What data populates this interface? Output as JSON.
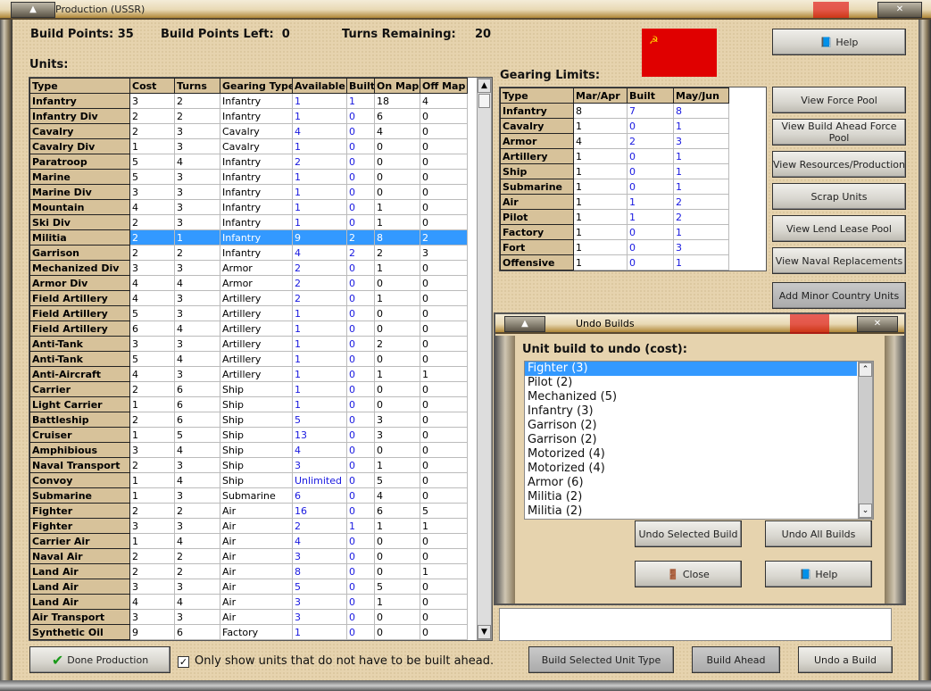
{
  "window": {
    "title": "Production (USSR)"
  },
  "stats": {
    "build_points": "Build Points: 35",
    "build_points_left": "Build Points Left:  0",
    "turns_remaining_label": "Turns Remaining:",
    "turns_remaining": "20"
  },
  "units": {
    "heading": "Units:",
    "columns": [
      "Type",
      "Cost",
      "Turns",
      "Gearing Type",
      "Available",
      "Built",
      "On Map",
      "Off Map"
    ],
    "selected_index": 9,
    "rows": [
      [
        "Infantry",
        "3",
        "2",
        "Infantry",
        "1",
        "1",
        "18",
        "4"
      ],
      [
        "Infantry Div",
        "2",
        "2",
        "Infantry",
        "1",
        "0",
        "6",
        "0"
      ],
      [
        "Cavalry",
        "2",
        "3",
        "Cavalry",
        "4",
        "0",
        "4",
        "0"
      ],
      [
        "Cavalry Div",
        "1",
        "3",
        "Cavalry",
        "1",
        "0",
        "0",
        "0"
      ],
      [
        "Paratroop",
        "5",
        "4",
        "Infantry",
        "2",
        "0",
        "0",
        "0"
      ],
      [
        "Marine",
        "5",
        "3",
        "Infantry",
        "1",
        "0",
        "0",
        "0"
      ],
      [
        "Marine Div",
        "3",
        "3",
        "Infantry",
        "1",
        "0",
        "0",
        "0"
      ],
      [
        "Mountain",
        "4",
        "3",
        "Infantry",
        "1",
        "0",
        "1",
        "0"
      ],
      [
        "Ski Div",
        "2",
        "3",
        "Infantry",
        "1",
        "0",
        "1",
        "0"
      ],
      [
        "Militia",
        "2",
        "1",
        "Infantry",
        "9",
        "2",
        "8",
        "2"
      ],
      [
        "Garrison",
        "2",
        "2",
        "Infantry",
        "4",
        "2",
        "2",
        "3"
      ],
      [
        "Mechanized Div",
        "3",
        "3",
        "Armor",
        "2",
        "0",
        "1",
        "0"
      ],
      [
        "Armor Div",
        "4",
        "4",
        "Armor",
        "2",
        "0",
        "0",
        "0"
      ],
      [
        "Field Artillery",
        "4",
        "3",
        "Artillery",
        "2",
        "0",
        "1",
        "0"
      ],
      [
        "Field Artillery",
        "5",
        "3",
        "Artillery",
        "1",
        "0",
        "0",
        "0"
      ],
      [
        "Field Artillery",
        "6",
        "4",
        "Artillery",
        "1",
        "0",
        "0",
        "0"
      ],
      [
        "Anti-Tank",
        "3",
        "3",
        "Artillery",
        "1",
        "0",
        "2",
        "0"
      ],
      [
        "Anti-Tank",
        "5",
        "4",
        "Artillery",
        "1",
        "0",
        "0",
        "0"
      ],
      [
        "Anti-Aircraft",
        "4",
        "3",
        "Artillery",
        "1",
        "0",
        "1",
        "1"
      ],
      [
        "Carrier",
        "2",
        "6",
        "Ship",
        "1",
        "0",
        "0",
        "0"
      ],
      [
        "Light Carrier",
        "1",
        "6",
        "Ship",
        "1",
        "0",
        "0",
        "0"
      ],
      [
        "Battleship",
        "2",
        "6",
        "Ship",
        "5",
        "0",
        "3",
        "0"
      ],
      [
        "Cruiser",
        "1",
        "5",
        "Ship",
        "13",
        "0",
        "3",
        "0"
      ],
      [
        "Amphibious",
        "3",
        "4",
        "Ship",
        "4",
        "0",
        "0",
        "0"
      ],
      [
        "Naval Transport",
        "2",
        "3",
        "Ship",
        "3",
        "0",
        "1",
        "0"
      ],
      [
        "Convoy",
        "1",
        "4",
        "Ship",
        "Unlimited",
        "0",
        "5",
        "0"
      ],
      [
        "Submarine",
        "1",
        "3",
        "Submarine",
        "6",
        "0",
        "4",
        "0"
      ],
      [
        "Fighter",
        "2",
        "2",
        "Air",
        "16",
        "0",
        "6",
        "5"
      ],
      [
        "Fighter",
        "3",
        "3",
        "Air",
        "2",
        "1",
        "1",
        "1"
      ],
      [
        "Carrier Air",
        "1",
        "4",
        "Air",
        "4",
        "0",
        "0",
        "0"
      ],
      [
        "Naval Air",
        "2",
        "2",
        "Air",
        "3",
        "0",
        "0",
        "0"
      ],
      [
        "Land Air",
        "2",
        "2",
        "Air",
        "8",
        "0",
        "0",
        "1"
      ],
      [
        "Land Air",
        "3",
        "3",
        "Air",
        "5",
        "0",
        "5",
        "0"
      ],
      [
        "Land Air",
        "4",
        "4",
        "Air",
        "3",
        "0",
        "1",
        "0"
      ],
      [
        "Air Transport",
        "3",
        "3",
        "Air",
        "3",
        "0",
        "0",
        "0"
      ],
      [
        "Synthetic Oil",
        "9",
        "6",
        "Factory",
        "1",
        "0",
        "0",
        "0"
      ]
    ]
  },
  "gearing": {
    "heading": "Gearing Limits:",
    "columns": [
      "Type",
      "Mar/Apr",
      "Built",
      "May/Jun"
    ],
    "rows": [
      [
        "Infantry",
        "8",
        "7",
        "8"
      ],
      [
        "Cavalry",
        "1",
        "0",
        "1"
      ],
      [
        "Armor",
        "4",
        "2",
        "3"
      ],
      [
        "Artillery",
        "1",
        "0",
        "1"
      ],
      [
        "Ship",
        "1",
        "0",
        "1"
      ],
      [
        "Submarine",
        "1",
        "0",
        "1"
      ],
      [
        "Air",
        "1",
        "1",
        "2"
      ],
      [
        "Pilot",
        "1",
        "1",
        "2"
      ],
      [
        "Factory",
        "1",
        "0",
        "1"
      ],
      [
        "Fort",
        "1",
        "0",
        "3"
      ],
      [
        "Offensive",
        "1",
        "0",
        "1"
      ]
    ]
  },
  "side_buttons": {
    "help": "Help",
    "view_force_pool": "View Force Pool",
    "view_build_ahead": "View Build Ahead Force Pool",
    "view_resources": "View Resources/Production",
    "scrap_units": "Scrap Units",
    "view_lend_lease": "View Lend Lease Pool",
    "view_naval": "View Naval Replacements",
    "add_minor": "Add Minor Country Units"
  },
  "undo": {
    "title": "Undo Builds",
    "label": "Unit build to undo (cost):",
    "items": [
      "Fighter (3)",
      "Pilot (2)",
      "Mechanized (5)",
      "Infantry (3)",
      "Garrison (2)",
      "Garrison (2)",
      "Motorized (4)",
      "Motorized (4)",
      "Armor (6)",
      "Militia (2)",
      "Militia (2)"
    ],
    "selected_index": 0,
    "undo_selected": "Undo Selected Build",
    "undo_all": "Undo All Builds",
    "close": "Close",
    "help": "Help"
  },
  "bottom": {
    "done": "Done Production",
    "checkbox_label": "Only show units that do not have to be built ahead.",
    "checkbox_checked": true,
    "build_selected": "Build Selected Unit Type",
    "build_ahead": "Build Ahead",
    "undo_build": "Undo a Build"
  },
  "colors": {
    "flag": "#e00000",
    "selection": "#3399ff",
    "header": "#d7c29a",
    "blue_value": "#1818e0"
  }
}
